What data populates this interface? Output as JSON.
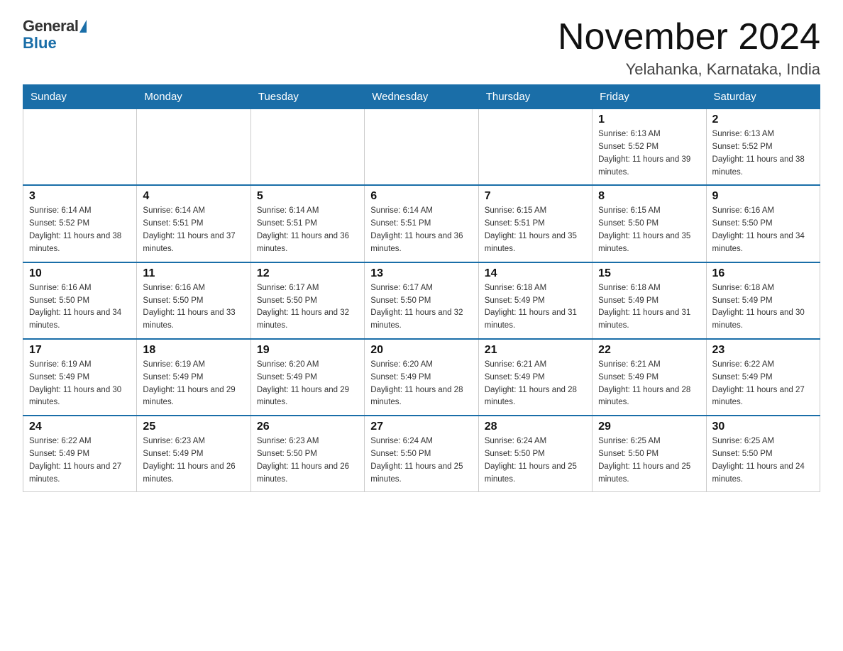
{
  "logo": {
    "general": "General",
    "blue": "Blue"
  },
  "header": {
    "month": "November 2024",
    "location": "Yelahanka, Karnataka, India"
  },
  "weekdays": [
    "Sunday",
    "Monday",
    "Tuesday",
    "Wednesday",
    "Thursday",
    "Friday",
    "Saturday"
  ],
  "weeks": [
    [
      {
        "day": "",
        "info": ""
      },
      {
        "day": "",
        "info": ""
      },
      {
        "day": "",
        "info": ""
      },
      {
        "day": "",
        "info": ""
      },
      {
        "day": "",
        "info": ""
      },
      {
        "day": "1",
        "info": "Sunrise: 6:13 AM\nSunset: 5:52 PM\nDaylight: 11 hours and 39 minutes."
      },
      {
        "day": "2",
        "info": "Sunrise: 6:13 AM\nSunset: 5:52 PM\nDaylight: 11 hours and 38 minutes."
      }
    ],
    [
      {
        "day": "3",
        "info": "Sunrise: 6:14 AM\nSunset: 5:52 PM\nDaylight: 11 hours and 38 minutes."
      },
      {
        "day": "4",
        "info": "Sunrise: 6:14 AM\nSunset: 5:51 PM\nDaylight: 11 hours and 37 minutes."
      },
      {
        "day": "5",
        "info": "Sunrise: 6:14 AM\nSunset: 5:51 PM\nDaylight: 11 hours and 36 minutes."
      },
      {
        "day": "6",
        "info": "Sunrise: 6:14 AM\nSunset: 5:51 PM\nDaylight: 11 hours and 36 minutes."
      },
      {
        "day": "7",
        "info": "Sunrise: 6:15 AM\nSunset: 5:51 PM\nDaylight: 11 hours and 35 minutes."
      },
      {
        "day": "8",
        "info": "Sunrise: 6:15 AM\nSunset: 5:50 PM\nDaylight: 11 hours and 35 minutes."
      },
      {
        "day": "9",
        "info": "Sunrise: 6:16 AM\nSunset: 5:50 PM\nDaylight: 11 hours and 34 minutes."
      }
    ],
    [
      {
        "day": "10",
        "info": "Sunrise: 6:16 AM\nSunset: 5:50 PM\nDaylight: 11 hours and 34 minutes."
      },
      {
        "day": "11",
        "info": "Sunrise: 6:16 AM\nSunset: 5:50 PM\nDaylight: 11 hours and 33 minutes."
      },
      {
        "day": "12",
        "info": "Sunrise: 6:17 AM\nSunset: 5:50 PM\nDaylight: 11 hours and 32 minutes."
      },
      {
        "day": "13",
        "info": "Sunrise: 6:17 AM\nSunset: 5:50 PM\nDaylight: 11 hours and 32 minutes."
      },
      {
        "day": "14",
        "info": "Sunrise: 6:18 AM\nSunset: 5:49 PM\nDaylight: 11 hours and 31 minutes."
      },
      {
        "day": "15",
        "info": "Sunrise: 6:18 AM\nSunset: 5:49 PM\nDaylight: 11 hours and 31 minutes."
      },
      {
        "day": "16",
        "info": "Sunrise: 6:18 AM\nSunset: 5:49 PM\nDaylight: 11 hours and 30 minutes."
      }
    ],
    [
      {
        "day": "17",
        "info": "Sunrise: 6:19 AM\nSunset: 5:49 PM\nDaylight: 11 hours and 30 minutes."
      },
      {
        "day": "18",
        "info": "Sunrise: 6:19 AM\nSunset: 5:49 PM\nDaylight: 11 hours and 29 minutes."
      },
      {
        "day": "19",
        "info": "Sunrise: 6:20 AM\nSunset: 5:49 PM\nDaylight: 11 hours and 29 minutes."
      },
      {
        "day": "20",
        "info": "Sunrise: 6:20 AM\nSunset: 5:49 PM\nDaylight: 11 hours and 28 minutes."
      },
      {
        "day": "21",
        "info": "Sunrise: 6:21 AM\nSunset: 5:49 PM\nDaylight: 11 hours and 28 minutes."
      },
      {
        "day": "22",
        "info": "Sunrise: 6:21 AM\nSunset: 5:49 PM\nDaylight: 11 hours and 28 minutes."
      },
      {
        "day": "23",
        "info": "Sunrise: 6:22 AM\nSunset: 5:49 PM\nDaylight: 11 hours and 27 minutes."
      }
    ],
    [
      {
        "day": "24",
        "info": "Sunrise: 6:22 AM\nSunset: 5:49 PM\nDaylight: 11 hours and 27 minutes."
      },
      {
        "day": "25",
        "info": "Sunrise: 6:23 AM\nSunset: 5:49 PM\nDaylight: 11 hours and 26 minutes."
      },
      {
        "day": "26",
        "info": "Sunrise: 6:23 AM\nSunset: 5:50 PM\nDaylight: 11 hours and 26 minutes."
      },
      {
        "day": "27",
        "info": "Sunrise: 6:24 AM\nSunset: 5:50 PM\nDaylight: 11 hours and 25 minutes."
      },
      {
        "day": "28",
        "info": "Sunrise: 6:24 AM\nSunset: 5:50 PM\nDaylight: 11 hours and 25 minutes."
      },
      {
        "day": "29",
        "info": "Sunrise: 6:25 AM\nSunset: 5:50 PM\nDaylight: 11 hours and 25 minutes."
      },
      {
        "day": "30",
        "info": "Sunrise: 6:25 AM\nSunset: 5:50 PM\nDaylight: 11 hours and 24 minutes."
      }
    ]
  ]
}
